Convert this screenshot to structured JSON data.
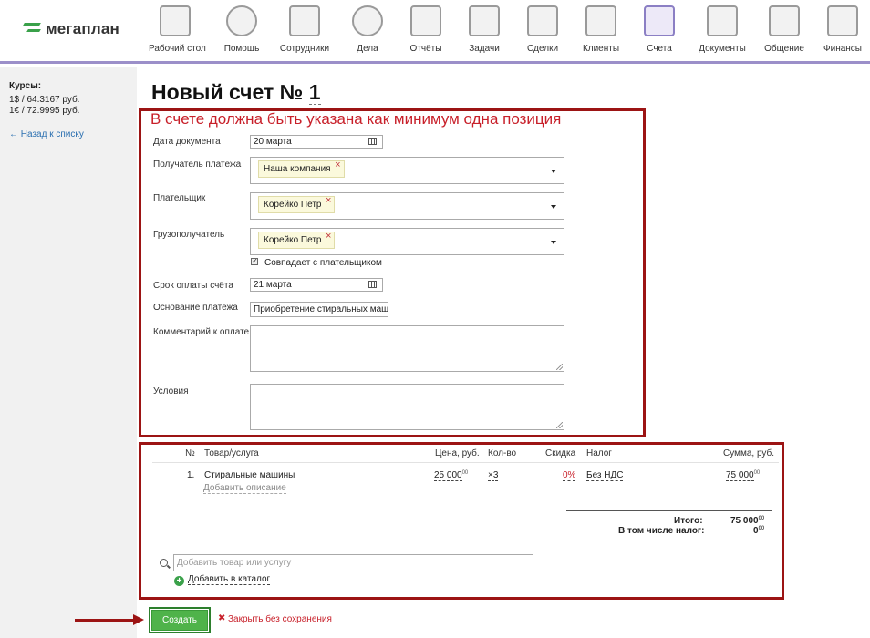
{
  "header": {
    "logo": "мегаплан",
    "nav": [
      {
        "label": "Рабочий стол",
        "icon": "desktop-icon"
      },
      {
        "label": "Помощь",
        "icon": "lifebuoy-icon"
      },
      {
        "label": "Сотрудники",
        "icon": "employees-icon"
      },
      {
        "label": "Дела",
        "icon": "clock-icon"
      },
      {
        "label": "Отчёты",
        "icon": "report-chart-icon"
      },
      {
        "label": "Задачи",
        "icon": "clipboard-check-icon"
      },
      {
        "label": "Сделки",
        "icon": "briefcase-icon"
      },
      {
        "label": "Клиенты",
        "icon": "address-book-icon"
      },
      {
        "label": "Счета",
        "icon": "invoices-icon",
        "active": true
      },
      {
        "label": "Документы",
        "icon": "folder-icon"
      },
      {
        "label": "Общение",
        "icon": "chat-icon"
      },
      {
        "label": "Финансы",
        "icon": "safe-icon"
      }
    ],
    "accent_color": "#9b8fc9"
  },
  "sidebar": {
    "rates_title": "Курсы:",
    "rate_usd": "1$ / 64.3167 руб.",
    "rate_eur": "1€ / 72.9995 руб.",
    "back_link": "← Назад к списку"
  },
  "page": {
    "title_prefix": "Новый счет №",
    "title_number": "1",
    "error_message": "В счете должна быть указана как минимум одна позиция"
  },
  "form": {
    "doc_date_label": "Дата документа",
    "doc_date_value": "20 марта",
    "payee_label": "Получатель платежа",
    "payee_value": "Наша компания",
    "payer_label": "Плательщик",
    "payer_value": "Корейко Петр",
    "consignee_label": "Грузополучатель",
    "consignee_value": "Корейко Петр",
    "same_as_payer_label": "Совпадает с плательщиком",
    "same_as_payer_checked": true,
    "due_date_label": "Срок оплаты счёта",
    "due_date_value": "21 марта",
    "basis_label": "Основание платежа",
    "basis_value": "Приобретение стиральных маш",
    "comment_label": "Комментарий к оплате",
    "comment_value": "",
    "terms_label": "Условия",
    "terms_value": ""
  },
  "items": {
    "headers": {
      "num": "№",
      "product": "Товар/услуга",
      "price": "Цена, руб.",
      "qty": "Кол-во",
      "discount": "Скидка",
      "tax": "Налог",
      "sum": "Сумма, руб."
    },
    "rows": [
      {
        "num": "1.",
        "product": "Стиральные машины",
        "add_description": "Добавить описание",
        "price": "25 000",
        "price_cents": "00",
        "qty": "×3",
        "discount": "0%",
        "tax": "Без НДС",
        "sum": "75 000",
        "sum_cents": "00"
      }
    ],
    "total_label": "Итого:",
    "total_value": "75 000",
    "total_cents": "00",
    "tax_total_label": "В том числе налог:",
    "tax_total_value": "0",
    "tax_total_cents": "00",
    "add_placeholder": "Добавить товар или услугу",
    "add_to_catalog": "Добавить в каталог"
  },
  "actions": {
    "create_label": "Создать",
    "close_label": "Закрыть без сохранения",
    "create_color": "#4fb34a",
    "error_color": "#c8202a"
  }
}
